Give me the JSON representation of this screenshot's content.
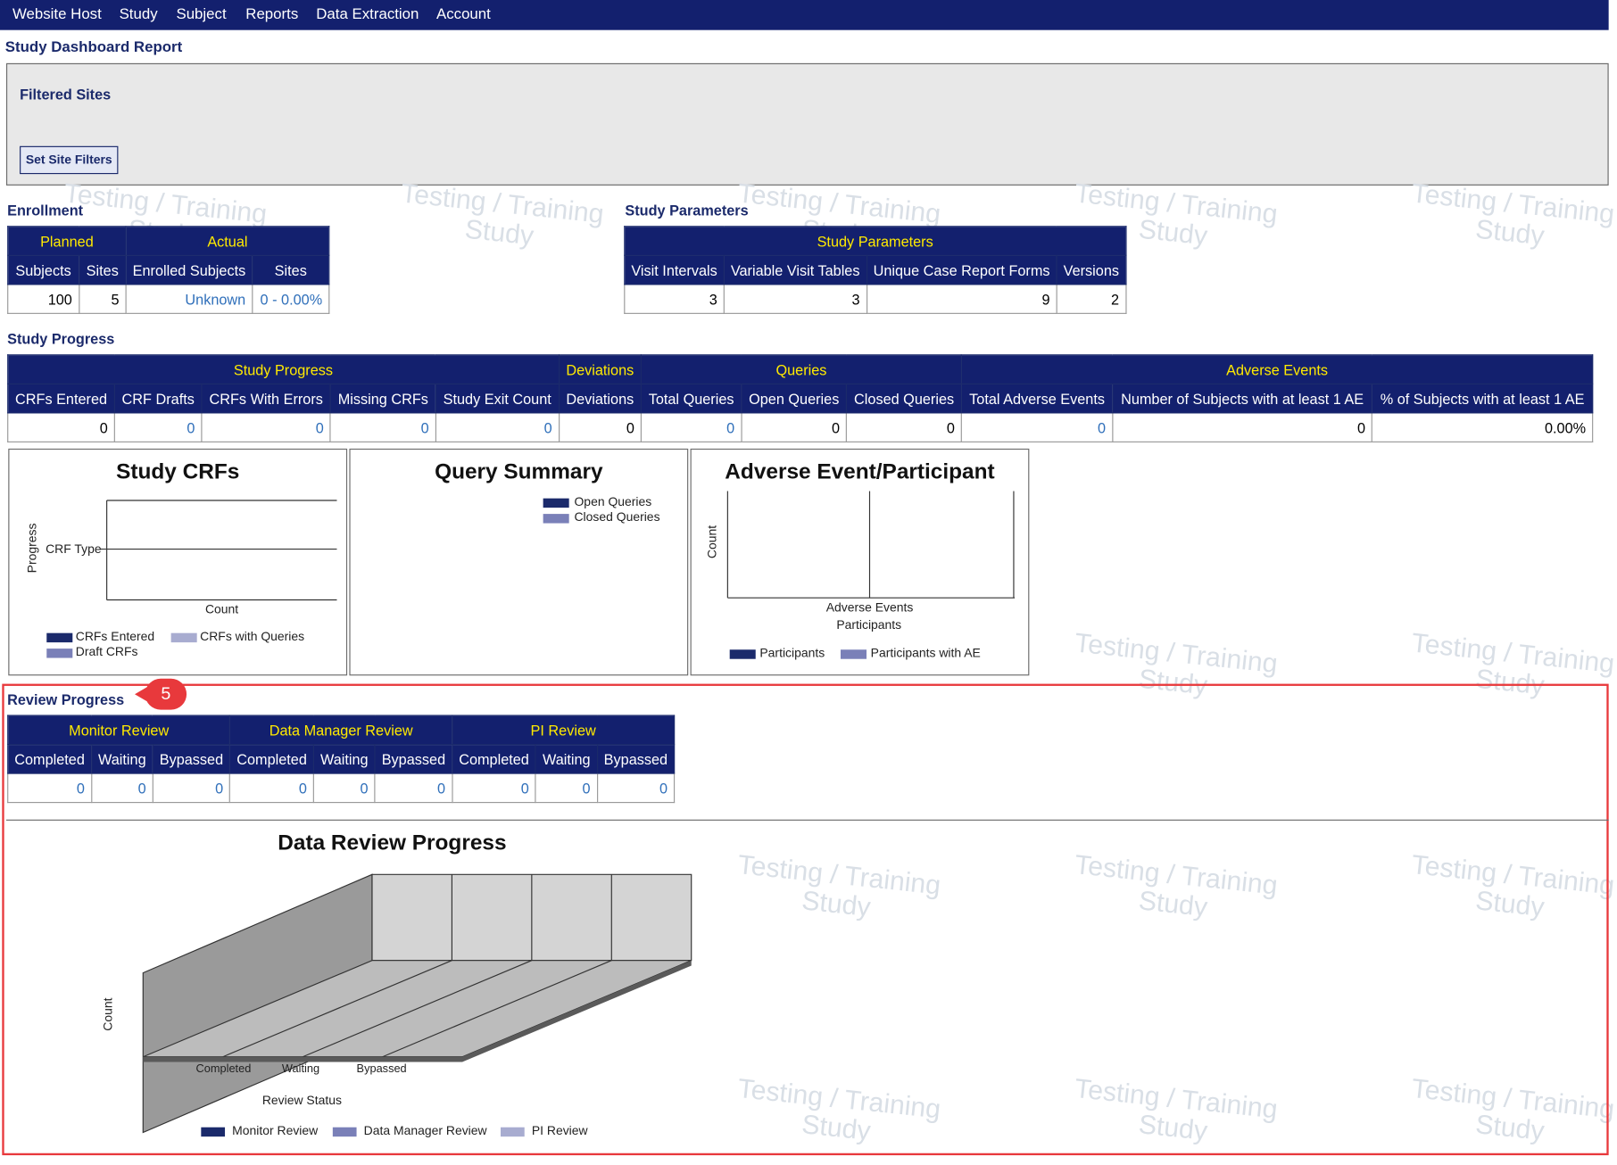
{
  "nav": [
    "Website Host",
    "Study",
    "Subject",
    "Reports",
    "Data Extraction",
    "Account"
  ],
  "page_title": "Study Dashboard Report",
  "filter": {
    "title": "Filtered Sites",
    "button": "Set Site Filters"
  },
  "watermark": {
    "line1": "Testing / Training",
    "line2": "Study"
  },
  "enrollment": {
    "label": "Enrollment",
    "groups": [
      "Planned",
      "Actual"
    ],
    "columns": [
      "Subjects",
      "Sites",
      "Enrolled Subjects",
      "Sites"
    ],
    "values": [
      "100",
      "5",
      "Unknown",
      "0 - 0.00%"
    ]
  },
  "study_parameters": {
    "label": "Study Parameters",
    "group": "Study Parameters",
    "columns": [
      "Visit Intervals",
      "Variable Visit Tables",
      "Unique Case Report Forms",
      "Versions"
    ],
    "values": [
      "3",
      "3",
      "9",
      "2"
    ]
  },
  "study_progress": {
    "label": "Study Progress",
    "groups": [
      "Study Progress",
      "Deviations",
      "Queries",
      "Adverse Events"
    ],
    "columns": [
      "CRFs Entered",
      "CRF Drafts",
      "CRFs With Errors",
      "Missing CRFs",
      "Study Exit Count",
      "Deviations",
      "Total Queries",
      "Open Queries",
      "Closed Queries",
      "Total Adverse Events",
      "Number of Subjects with at least 1 AE",
      "% of Subjects with at least 1 AE"
    ],
    "values": [
      "0",
      "0",
      "0",
      "0",
      "0",
      "0",
      "0",
      "0",
      "0",
      "0",
      "0",
      "0.00%"
    ]
  },
  "charts": {
    "crfs": {
      "title": "Study CRFs",
      "ylabel": "Progress",
      "tick": "CRF Type",
      "xlabel": "Count",
      "legend": [
        "CRFs Entered",
        "CRFs with Queries",
        "Draft CRFs"
      ]
    },
    "query": {
      "title": "Query Summary",
      "legend": [
        "Open Queries",
        "Closed Queries"
      ]
    },
    "ae": {
      "title": "Adverse Event/Participant",
      "ylabel": "Count",
      "xlabel1": "Adverse Events",
      "xlabel2": "Participants",
      "legend": [
        "Participants",
        "Participants with AE"
      ]
    }
  },
  "review_progress": {
    "label": "Review Progress",
    "badge": "5",
    "groups": [
      "Monitor Review",
      "Data Manager Review",
      "PI Review"
    ],
    "columns": [
      "Completed",
      "Waiting",
      "Bypassed",
      "Completed",
      "Waiting",
      "Bypassed",
      "Completed",
      "Waiting",
      "Bypassed"
    ],
    "values": [
      "0",
      "0",
      "0",
      "0",
      "0",
      "0",
      "0",
      "0",
      "0"
    ]
  },
  "data_review_chart": {
    "title": "Data Review Progress",
    "ylabel": "Count",
    "xlabel": "Review Status",
    "categories": [
      "Completed",
      "Waiting",
      "Bypassed"
    ],
    "legend": [
      "Monitor Review",
      "Data Manager Review",
      "PI Review"
    ]
  },
  "colors": {
    "navy": "#13206e",
    "gold": "#ffea00",
    "link": "#2f6fba",
    "s1": "#1b2a6b",
    "s2": "#7a80b8",
    "s3": "#a8acd0",
    "highlight": "#e8393c"
  }
}
